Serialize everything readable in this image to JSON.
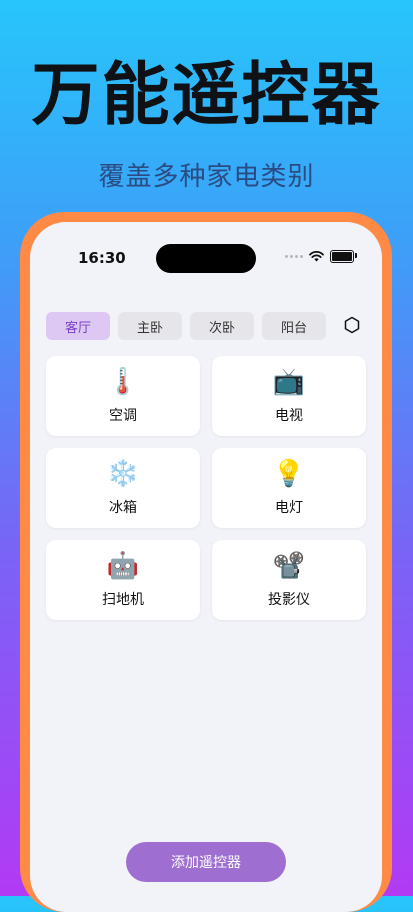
{
  "hero": {
    "title": "万能遥控器",
    "subtitle": "覆盖多种家电类别"
  },
  "status_bar": {
    "time": "16:30",
    "icons": [
      "signal-dots-icon",
      "wifi-icon",
      "battery-icon"
    ]
  },
  "rooms": {
    "tabs": [
      {
        "label": "客厅",
        "active": true
      },
      {
        "label": "主卧",
        "active": false
      },
      {
        "label": "次卧",
        "active": false
      },
      {
        "label": "阳台",
        "active": false
      }
    ],
    "settings_icon": "hexagon-settings-icon"
  },
  "devices": [
    {
      "label": "空调",
      "icon": "🌡️",
      "icon_name": "thermometer-icon"
    },
    {
      "label": "电视",
      "icon": "📺",
      "icon_name": "television-icon"
    },
    {
      "label": "冰箱",
      "icon": "❄️",
      "icon_name": "snowflake-icon"
    },
    {
      "label": "电灯",
      "icon": "💡",
      "icon_name": "light-bulb-icon"
    },
    {
      "label": "扫地机",
      "icon": "🤖",
      "icon_name": "robot-icon"
    },
    {
      "label": "投影仪",
      "icon": "📽️",
      "icon_name": "projector-icon"
    }
  ],
  "actions": {
    "add_remote_label": "添加遥控器"
  },
  "colors": {
    "accent": "#9e6fd0",
    "active_tab_bg": "#dcc8f2",
    "phone_frame": "#ff8a45"
  }
}
